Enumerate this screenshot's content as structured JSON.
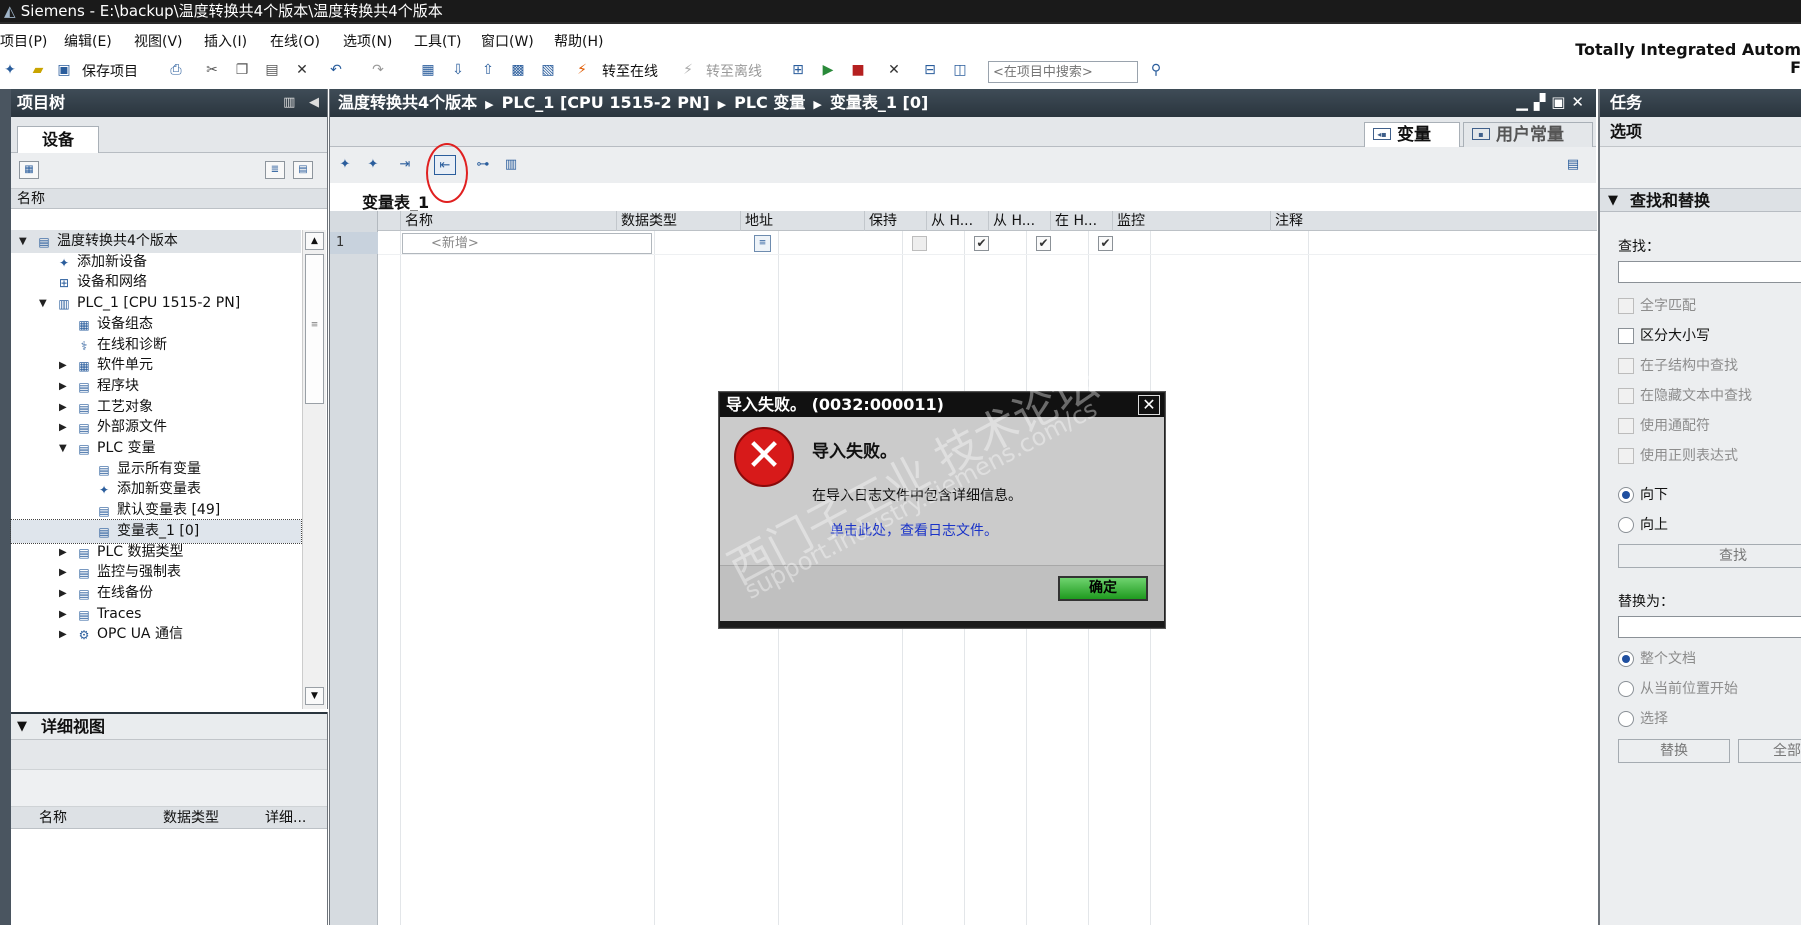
{
  "window": {
    "title": "Siemens  -  E:\\backup\\温度转换共4个版本\\温度转换共4个版本"
  },
  "menu": [
    "项目(P)",
    "编辑(E)",
    "视图(V)",
    "插入(I)",
    "在线(O)",
    "选项(N)",
    "工具(T)",
    "窗口(W)",
    "帮助(H)"
  ],
  "brand": "Totally Integrated Autom",
  "brand_sub": "F",
  "toolbar": {
    "save_project": "保存项目",
    "go_online": "转至在线",
    "go_offline": "转至离线",
    "search_placeholder": "<在项目中搜索>"
  },
  "project_tree": {
    "title": "项目树",
    "tab_devices": "设备",
    "column_name": "名称",
    "items": [
      {
        "label": "温度转换共4个版本",
        "level": 0,
        "expanded": true
      },
      {
        "label": "添加新设备",
        "level": 1
      },
      {
        "label": "设备和网络",
        "level": 1
      },
      {
        "label": "PLC_1 [CPU 1515-2 PN]",
        "level": 1,
        "expanded": true
      },
      {
        "label": "设备组态",
        "level": 2
      },
      {
        "label": "在线和诊断",
        "level": 2
      },
      {
        "label": "软件单元",
        "level": 2,
        "collapsed": true
      },
      {
        "label": "程序块",
        "level": 2,
        "collapsed": true
      },
      {
        "label": "工艺对象",
        "level": 2,
        "collapsed": true
      },
      {
        "label": "外部源文件",
        "level": 2,
        "collapsed": true
      },
      {
        "label": "PLC 变量",
        "level": 2,
        "expanded": true
      },
      {
        "label": "显示所有变量",
        "level": 3
      },
      {
        "label": "添加新变量表",
        "level": 3
      },
      {
        "label": "默认变量表 [49]",
        "level": 3
      },
      {
        "label": "变量表_1 [0]",
        "level": 3,
        "selected": true
      },
      {
        "label": "PLC 数据类型",
        "level": 2,
        "collapsed": true
      },
      {
        "label": "监控与强制表",
        "level": 2,
        "collapsed": true
      },
      {
        "label": "在线备份",
        "level": 2,
        "collapsed": true
      },
      {
        "label": "Traces",
        "level": 2,
        "collapsed": true
      },
      {
        "label": "OPC UA 通信",
        "level": 2,
        "collapsed": true
      }
    ]
  },
  "detail_view": {
    "title": "详细视图",
    "columns": [
      "名称",
      "数据类型",
      "详细..."
    ]
  },
  "editor": {
    "breadcrumb": [
      "温度转换共4个版本",
      "PLC_1 [CPU 1515-2 PN]",
      "PLC 变量",
      "变量表_1 [0]"
    ],
    "tab_tags": "变量",
    "tab_user_constants": "用户常量",
    "table_title": "变量表_1",
    "columns": [
      "名称",
      "数据类型",
      "地址",
      "保持",
      "从 H...",
      "从 H...",
      "在 H...",
      "监控",
      "注释"
    ],
    "row_number": "1",
    "new_row_placeholder": "<新增>"
  },
  "dialog": {
    "title": "导入失败。 (0032:000011)",
    "heading": "导入失败。",
    "message": "在导入日志文件中包含详细信息。",
    "link": "单击此处，查看日志文件。",
    "ok": "确定"
  },
  "watermark": {
    "text": "西门子工业 技术论坛",
    "url": "support.industry.siemens.com/cs"
  },
  "task_pane": {
    "title": "任务",
    "options": "选项",
    "find_replace": "查找和替换",
    "find_label": "查找：",
    "options_list": [
      {
        "label": "全字匹配",
        "disabled": true
      },
      {
        "label": "区分大小写",
        "disabled": false
      },
      {
        "label": "在子结构中查找",
        "disabled": true
      },
      {
        "label": "在隐藏文本中查找",
        "disabled": true
      },
      {
        "label": "使用通配符",
        "disabled": true
      },
      {
        "label": "使用正则表达式",
        "disabled": true
      }
    ],
    "direction_down": "向下",
    "direction_up": "向上",
    "find_button": "查找",
    "replace_label": "替换为：",
    "scope_whole": "整个文档",
    "scope_from_current": "从当前位置开始",
    "scope_selection": "选择",
    "replace_button": "替换",
    "replace_all_button": "全部替"
  }
}
